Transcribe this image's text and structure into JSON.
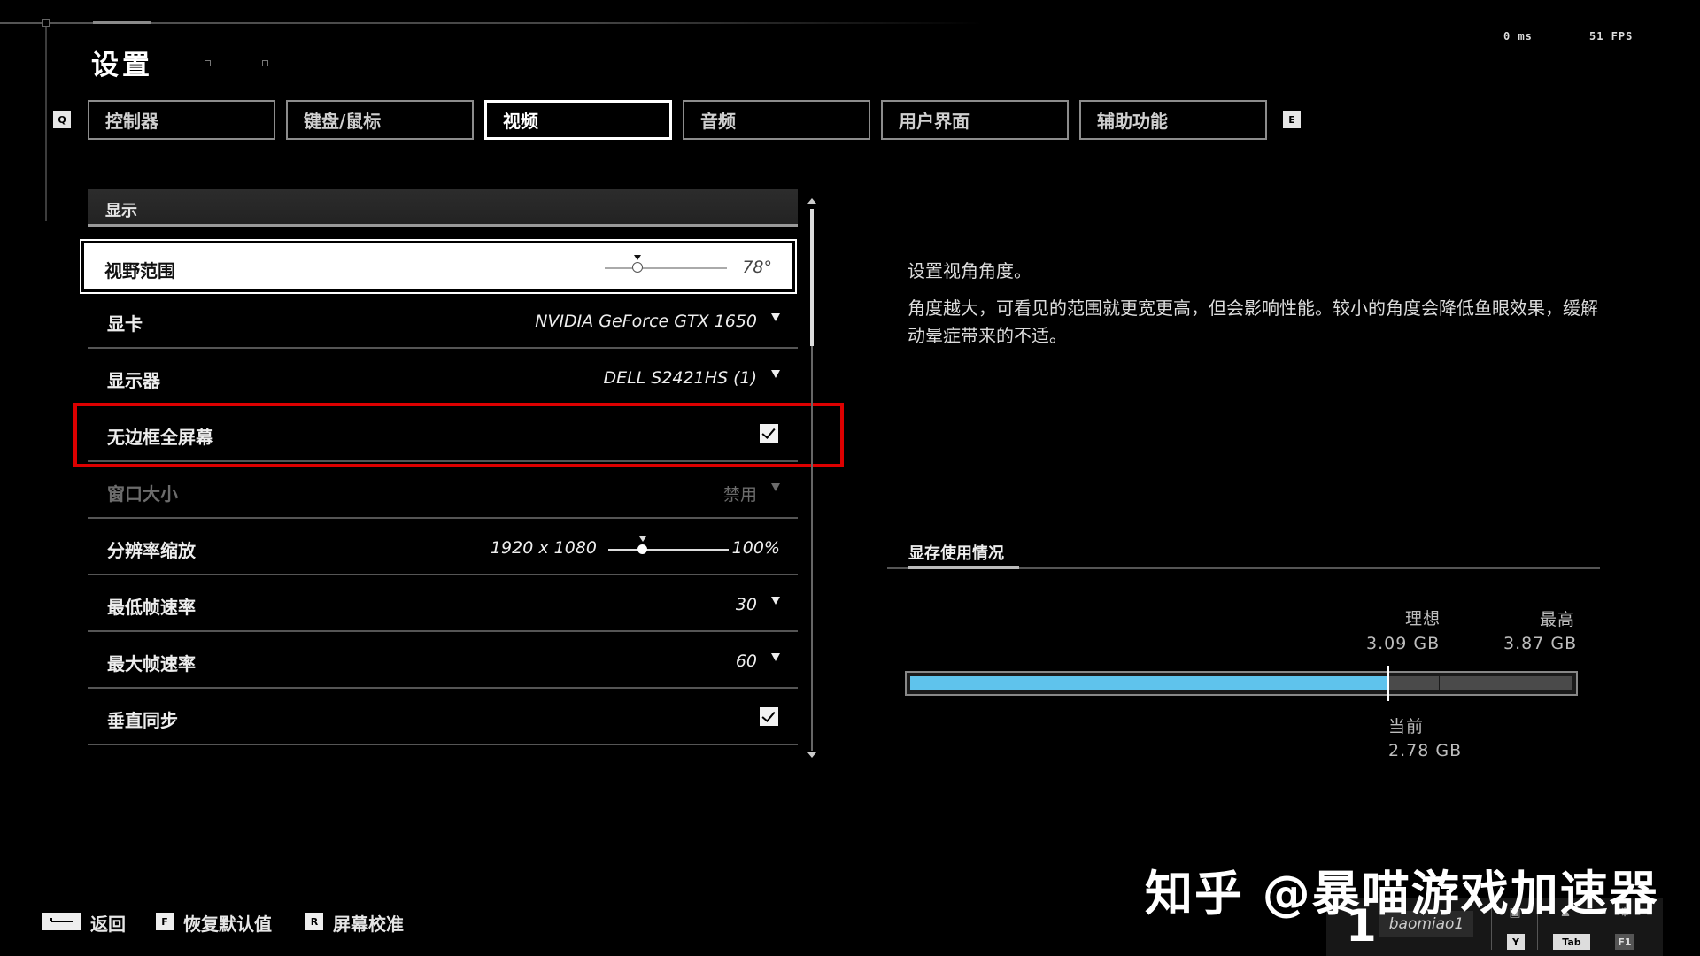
{
  "header": {
    "title": "设置",
    "latency": "0 ms",
    "fps": "51 FPS"
  },
  "tabs": {
    "prev_key": "Q",
    "next_key": "E",
    "items": [
      {
        "label": "控制器"
      },
      {
        "label": "键盘/鼠标"
      },
      {
        "label": "视频"
      },
      {
        "label": "音频"
      },
      {
        "label": "用户界面"
      },
      {
        "label": "辅助功能"
      }
    ],
    "active": "视频"
  },
  "settings": {
    "section_title": "显示",
    "rows": [
      {
        "label": "视野范围",
        "value": "78°",
        "type": "slider",
        "slider_fraction": 0.27
      },
      {
        "label": "显卡",
        "value": "NVIDIA GeForce GTX 1650",
        "type": "dropdown"
      },
      {
        "label": "显示器",
        "value": "DELL S2421HS (1)",
        "type": "dropdown"
      },
      {
        "label": "无边框全屏幕",
        "type": "checkbox",
        "checked": true
      },
      {
        "label": "窗口大小",
        "value": "禁用",
        "type": "dropdown",
        "disabled": true
      },
      {
        "label": "分辨率缩放",
        "value": "100%",
        "resolution": "1920 x 1080",
        "type": "slider",
        "slider_fraction": 0.27
      },
      {
        "label": "最低帧速率",
        "value": "30",
        "type": "dropdown"
      },
      {
        "label": "最大帧速率",
        "value": "60",
        "type": "dropdown"
      },
      {
        "label": "垂直同步",
        "type": "checkbox",
        "checked": true
      }
    ]
  },
  "description": {
    "title": "设置视角角度。",
    "body": "角度越大，可看见的范围就更宽更高，但会影响性能。较小的角度会降低鱼眼效果，缓解动晕症带来的不适。"
  },
  "vram": {
    "title": "显存使用情况",
    "ideal_label": "理想",
    "ideal_value": "3.09 GB",
    "max_label": "最高",
    "max_value": "3.87 GB",
    "current_label": "当前",
    "current_value": "2.78 GB",
    "current_fraction": 0.72,
    "ideal_fraction": 0.8,
    "fill_color": "#5fc3ec"
  },
  "footer": {
    "back_label": "返回",
    "reset_key": "F",
    "reset_label": "恢复默认值",
    "calibrate_key": "R",
    "calibrate_label": "屏幕校准"
  },
  "watermark": "知乎 @暴喵游戏加速器",
  "user": {
    "number": "1",
    "name": "baomiao1",
    "keys": [
      "Y",
      "Tab",
      "F1"
    ]
  }
}
